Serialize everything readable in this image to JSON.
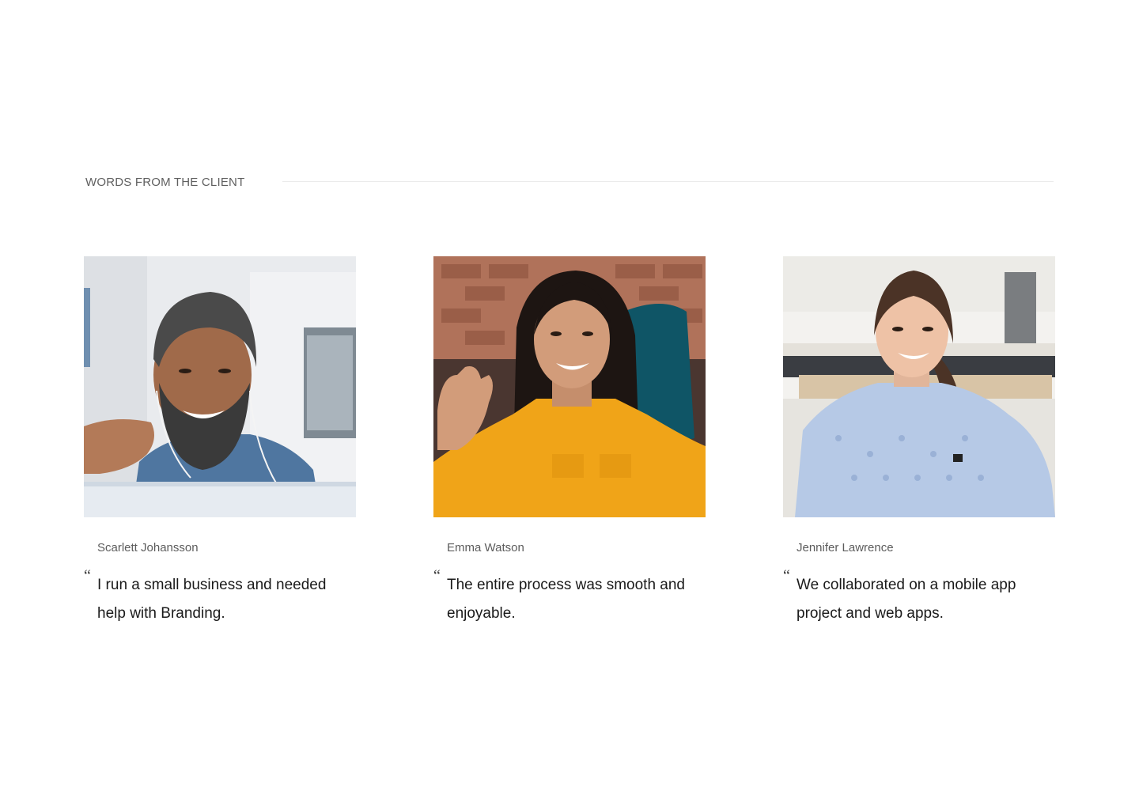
{
  "section": {
    "label": "WORDS FROM THE CLIENT"
  },
  "testimonials": [
    {
      "name": "Scarlett Johansson",
      "quote_mark": "“",
      "quote": "I run a small business and needed help with Branding.",
      "photo": "smiling bearded man with earphones on a video call"
    },
    {
      "name": "Emma Watson",
      "quote_mark": "“",
      "quote": "The entire process was smooth and enjoyable.",
      "photo": "smiling woman in yellow shirt waving"
    },
    {
      "name": "Jennifer Lawrence",
      "quote_mark": "“",
      "quote": "We collaborated on a mobile app project and web apps.",
      "photo": "smiling woman with braid in light blue sweater"
    }
  ]
}
